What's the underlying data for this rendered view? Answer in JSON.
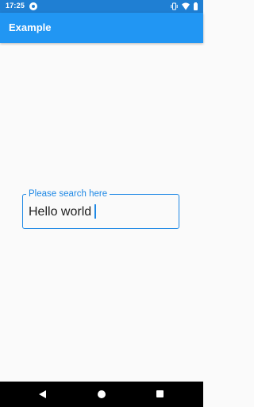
{
  "status_bar": {
    "time": "17:25",
    "icons": [
      "media-icon",
      "vibrate-icon",
      "wifi-icon",
      "battery-icon"
    ]
  },
  "app_bar": {
    "title": "Example",
    "color": "#2196f3"
  },
  "search": {
    "label": "Please search here",
    "value": "Hello world",
    "focused": true,
    "accent_color": "#1e88e5"
  },
  "nav_bar": {
    "buttons": [
      "back-icon",
      "home-icon",
      "recents-icon"
    ]
  }
}
